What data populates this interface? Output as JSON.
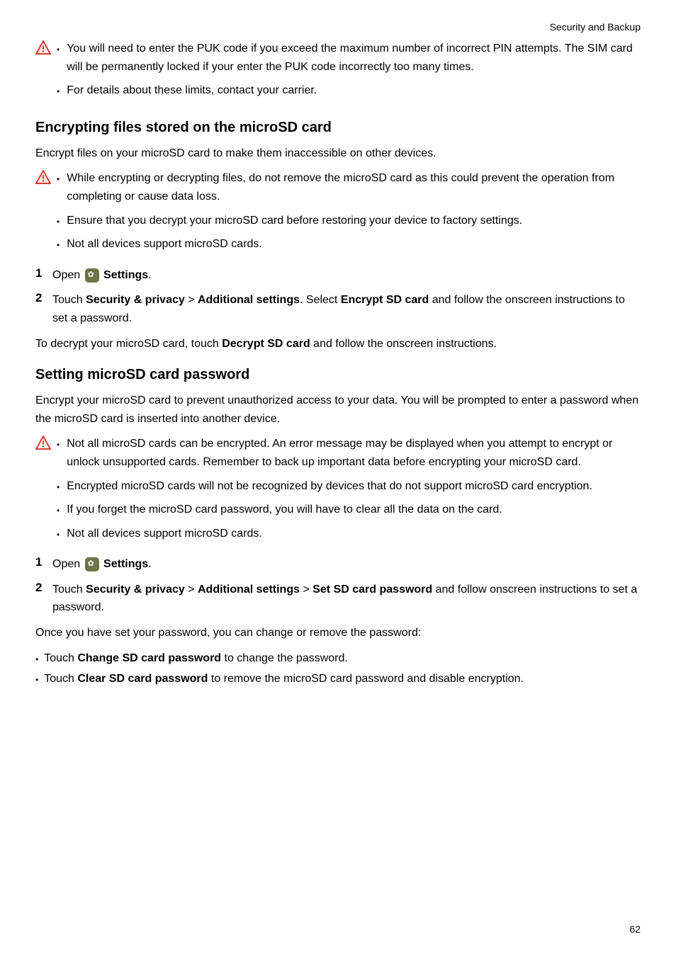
{
  "header": "Security and Backup",
  "warn1": {
    "item1": "You will need to enter the PUK code if you exceed the maximum number of incorrect PIN attempts. The SIM card will be permanently locked if your enter the PUK code incorrectly too many times.",
    "item2": "For details about these limits, contact your carrier."
  },
  "sec1": {
    "title": "Encrypting files stored on the microSD card",
    "intro": "Encrypt files on your microSD card to make them inaccessible on other devices.",
    "warn": {
      "item1": "While encrypting or decrypting files, do not remove the microSD card as this could prevent the operation from completing or cause data loss.",
      "item2": "Ensure that you decrypt your microSD card before restoring your device to factory settings.",
      "item3": "Not all devices support microSD cards."
    },
    "step1_a": "Open ",
    "step1_b": " Settings",
    "step1_c": ".",
    "step2_a": "Touch ",
    "step2_b": "Security & privacy",
    "step2_c": " > ",
    "step2_d": "Additional settings",
    "step2_e": ". Select ",
    "step2_f": "Encrypt SD card",
    "step2_g": " and follow the onscreen instructions to set a password.",
    "outro_a": "To decrypt your microSD card, touch ",
    "outro_b": "Decrypt SD card",
    "outro_c": " and follow the onscreen instructions."
  },
  "sec2": {
    "title": "Setting microSD card password",
    "intro": "Encrypt your microSD card to prevent unauthorized access to your data. You will be prompted to enter a password when the microSD card is inserted into another device.",
    "warn": {
      "item1": "Not all microSD cards can be encrypted. An error message may be displayed when you attempt to encrypt or unlock unsupported cards. Remember to back up important data before encrypting your microSD card.",
      "item2": "Encrypted microSD cards will not be recognized by devices that do not support microSD card encryption.",
      "item3": "If you forget the microSD card password, you will have to clear all the data on the card.",
      "item4": "Not all devices support microSD cards."
    },
    "step1_a": "Open ",
    "step1_b": " Settings",
    "step1_c": ".",
    "step2_a": "Touch ",
    "step2_b": "Security & privacy",
    "step2_c": " > ",
    "step2_d": "Additional settings",
    "step2_e": " > ",
    "step2_f": "Set SD card password",
    "step2_g": " and follow onscreen instructions to set a password.",
    "outro": "Once you have set your password, you can change or remove the password:",
    "b1_a": "Touch ",
    "b1_b": "Change SD card password",
    "b1_c": " to change the password.",
    "b2_a": "Touch ",
    "b2_b": "Clear SD card password",
    "b2_c": " to remove the microSD card password and disable encryption."
  },
  "pagenum": "62"
}
